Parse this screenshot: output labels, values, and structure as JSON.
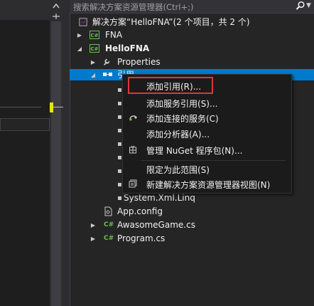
{
  "search": {
    "placeholder": "搜索解决方案资源管理器(Ctrl+;)",
    "icon": "search-icon"
  },
  "tree": {
    "solution": "解决方案“HelloFNA”(2 个项目，共 2 个)",
    "items": [
      {
        "label": "FNA",
        "icon": "csharp-project-icon"
      },
      {
        "label": "HelloFNA",
        "icon": "csharp-project-icon"
      },
      {
        "label": "Properties",
        "icon": "wrench-icon"
      },
      {
        "label": "引用",
        "icon": "references-icon"
      },
      {
        "label": "System.Xml.Linq",
        "icon": "assembly-icon"
      },
      {
        "label": "App.config",
        "icon": "config-file-icon"
      },
      {
        "label": "AwasomeGame.cs",
        "icon": "csharp-file-icon"
      },
      {
        "label": "Program.cs",
        "icon": "csharp-file-icon"
      }
    ]
  },
  "context_menu": {
    "items": [
      {
        "label": "添加引用(R)...",
        "icon": ""
      },
      {
        "label": "添加服务引用(S)...",
        "icon": ""
      },
      {
        "label": "添加连接的服务(C)",
        "icon": "connected-service-icon"
      },
      {
        "label": "添加分析器(A)...",
        "icon": ""
      },
      {
        "label": "管理 NuGet 程序包(N)...",
        "icon": "nuget-icon"
      },
      {
        "label": "限定为此范围(S)",
        "icon": ""
      },
      {
        "label": "新建解决方案资源管理器视图(N)",
        "icon": "new-view-icon"
      }
    ]
  },
  "colors": {
    "selection": "#007acc",
    "highlight_border": "#e2343a",
    "csharp": "#6fbf4a",
    "marker": "#e6e600"
  }
}
